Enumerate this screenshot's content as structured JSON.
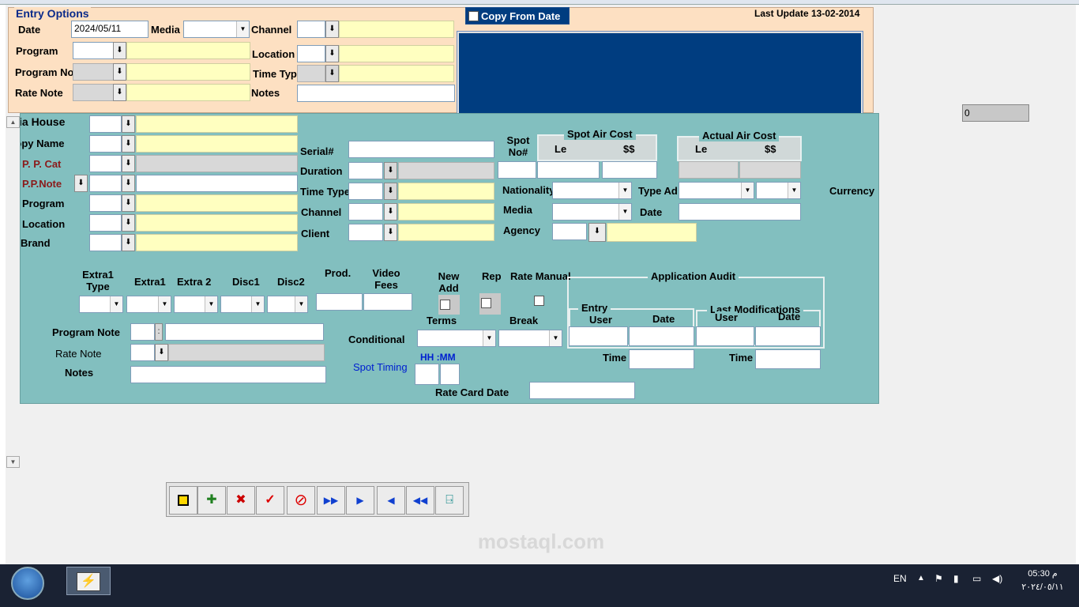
{
  "entry": {
    "group_title": "Entry Options",
    "date_label": "Date",
    "date_value": "2024/05/11",
    "media_label": "Media",
    "channel_label": "Channel",
    "program_label": "Program",
    "location_label": "Location",
    "program_no_label": "Program No",
    "time_type_label": "Time Type",
    "rate_note_label": "Rate Note",
    "notes_label": "Notes",
    "copy_from_date": "Copy From Date",
    "last_update": "Last Update 13-02-2014",
    "side_value": "0"
  },
  "detail": {
    "media_house": "Media House",
    "copy_name": "Copy Name",
    "pp_cat": "P. P. Cat",
    "pp_note": "P.P.Note",
    "program": "Program",
    "location": "Location",
    "brand": "Brand",
    "serial": "Serial#",
    "duration": "Duration",
    "time_type": "Time Type",
    "channel": "Channel",
    "client": "Client",
    "spot_no": "Spot No#",
    "spot_air_cost": "Spot Air Cost",
    "actual_air_cost": "Actual Air Cost",
    "le": "Le",
    "usd": "$$",
    "nationality": "Nationality",
    "type_ad": "Type Ad",
    "currency": "Currency",
    "media": "Media",
    "date": "Date",
    "agency": "Agency",
    "extra1_type": "Extra1 Type",
    "extra1": "Extra1",
    "extra2": "Extra 2",
    "disc1": "Disc1",
    "disc2": "Disc2",
    "prod": "Prod.",
    "video_fees": "Video Fees",
    "new_add": "New Add",
    "rep": "Rep",
    "rate_manual": "Rate Manual",
    "terms": "Terms",
    "break": "Break",
    "application_audit": "Application Audit",
    "entry": "Entry",
    "last_modifications": "Last Modifications",
    "user": "User",
    "date_col": "Date",
    "time": "Time",
    "program_note": "Program Note",
    "rate_note": "Rate Note",
    "notes": "Notes",
    "conditional": "Conditional",
    "spot_timing": "Spot Timing",
    "hhmm": "HH :MM",
    "rate_card_date": "Rate Card Date"
  },
  "toolbar": {
    "items": [
      "save-icon",
      "new-record-icon",
      "delete-record-icon",
      "confirm-icon",
      "cancel-icon",
      "last-record-icon",
      "next-record-icon",
      "previous-record-icon",
      "first-record-icon",
      "exit-icon"
    ]
  },
  "taskbar": {
    "lang": "EN",
    "time": "05:30 م",
    "date": "٢٠٢٤/٠٥/١١"
  },
  "watermark": {
    "text": "mostaql.com"
  }
}
